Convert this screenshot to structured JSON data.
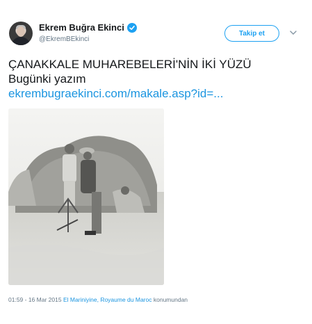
{
  "user": {
    "name": "Ekrem Buğra Ekinci",
    "handle": "@EkremBEkinci",
    "verified_icon": "verified-badge-icon"
  },
  "follow_button": {
    "label": "Takip et"
  },
  "menu_icon": "chevron-down-icon",
  "tweet": {
    "line1": "ÇANAKKALE MUHAREBELERİ'NİN İKİ YÜZÜ",
    "line2": "Bugünki yazım",
    "link": "ekrembugraekinci.com/makale.asp?id=..."
  },
  "photo": {
    "description_icon": "photo-image"
  },
  "meta": {
    "timestamp": "01:59 - 16 Mar 2015",
    "location": "El Mariniyine, Royaume du Maroc",
    "suffix": "konumundan"
  },
  "colors": {
    "accent": "#1da1f2",
    "link": "#1b95e0",
    "muted": "#657786"
  }
}
